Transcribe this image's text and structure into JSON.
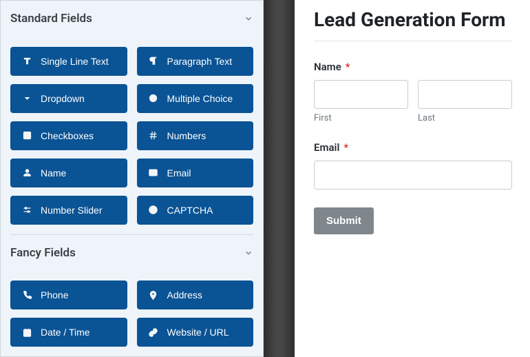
{
  "sidebar": {
    "sections": [
      {
        "title": "Standard Fields",
        "items": [
          {
            "label": "Single Line Text",
            "icon": "text"
          },
          {
            "label": "Paragraph Text",
            "icon": "paragraph"
          },
          {
            "label": "Dropdown",
            "icon": "caret"
          },
          {
            "label": "Multiple Choice",
            "icon": "radio"
          },
          {
            "label": "Checkboxes",
            "icon": "check"
          },
          {
            "label": "Numbers",
            "icon": "hash"
          },
          {
            "label": "Name",
            "icon": "user"
          },
          {
            "label": "Email",
            "icon": "mail"
          },
          {
            "label": "Number Slider",
            "icon": "sliders"
          },
          {
            "label": "CAPTCHA",
            "icon": "help"
          }
        ]
      },
      {
        "title": "Fancy Fields",
        "items": [
          {
            "label": "Phone",
            "icon": "phone"
          },
          {
            "label": "Address",
            "icon": "pin"
          },
          {
            "label": "Date / Time",
            "icon": "calendar"
          },
          {
            "label": "Website / URL",
            "icon": "link"
          }
        ]
      }
    ]
  },
  "preview": {
    "title": "Lead Generation Form",
    "name_label": "Name",
    "first_label": "First",
    "last_label": "Last",
    "email_label": "Email",
    "submit_label": "Submit",
    "required_mark": "*"
  },
  "colors": {
    "field_button_bg": "#0a5394",
    "required": "#d93025"
  }
}
